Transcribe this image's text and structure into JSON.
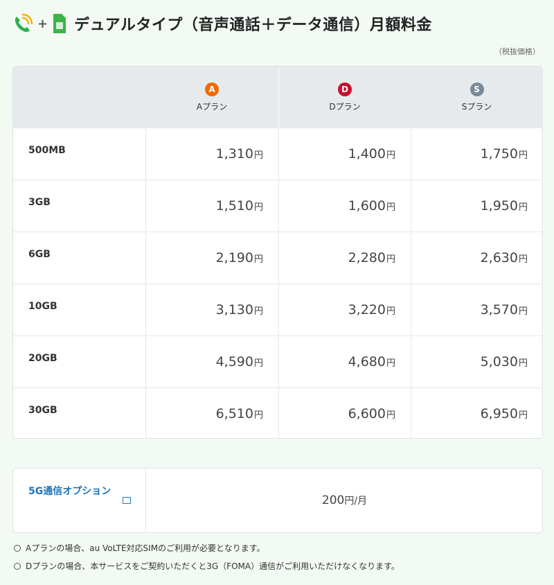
{
  "header": {
    "title": "デュアルタイプ（音声通話＋データ通信）月額料金",
    "plus": "+",
    "tax_note": "（税抜価格）"
  },
  "colors": {
    "phone_icon": "#2eb04d",
    "signal_icon": "#f0b000",
    "sim_icon": "#3bb54a",
    "plan_a": "#f06a00",
    "plan_d": "#c8102e",
    "plan_s": "#7b8a99",
    "link": "#1c74b8"
  },
  "table": {
    "plans": [
      {
        "badge": "A",
        "name": "Aプラン"
      },
      {
        "badge": "D",
        "name": "Dプラン"
      },
      {
        "badge": "S",
        "name": "Sプラン"
      }
    ],
    "currency": "円",
    "rows": [
      {
        "data": "500MB",
        "prices": [
          "1,310",
          "1,400",
          "1,750"
        ]
      },
      {
        "data": "3GB",
        "prices": [
          "1,510",
          "1,600",
          "1,950"
        ]
      },
      {
        "data": "6GB",
        "prices": [
          "2,190",
          "2,280",
          "2,630"
        ]
      },
      {
        "data": "10GB",
        "prices": [
          "3,130",
          "3,220",
          "3,570"
        ]
      },
      {
        "data": "20GB",
        "prices": [
          "4,590",
          "4,680",
          "5,030"
        ]
      },
      {
        "data": "30GB",
        "prices": [
          "6,510",
          "6,600",
          "6,950"
        ]
      }
    ]
  },
  "option": {
    "label": "5G通信オプション",
    "price": "200",
    "unit": "円/月"
  },
  "notes": [
    "Aプランの場合、au VoLTE対応SIMのご利用が必要となります。",
    "Dプランの場合、本サービスをご契約いただくと3G（FOMA）通信がご利用いただけなくなります。"
  ]
}
